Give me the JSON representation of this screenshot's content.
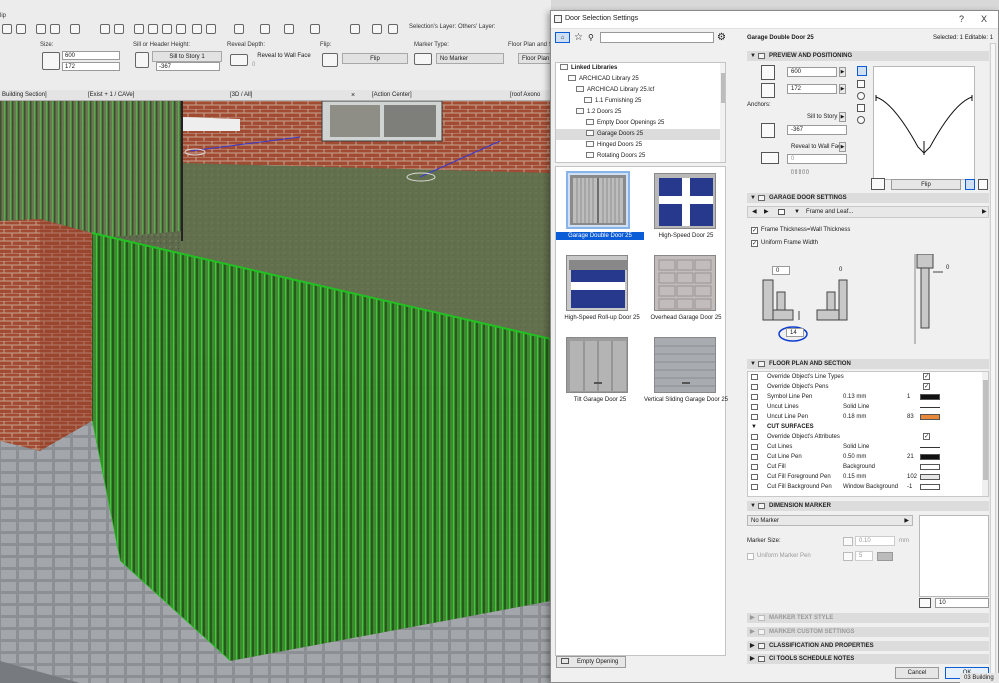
{
  "toolbar": {
    "partial_label": "lip",
    "size_label": "Size:",
    "width": "600",
    "height": "172",
    "sill_label": "Sill or Header Height:",
    "sill_mode": "Sill to Story 1",
    "sill_value": "-367",
    "reveal_label": "Reveal Depth:",
    "reveal_mode": "Reveal to Wall Face",
    "reveal_value": "0",
    "flip_label": "Flip:",
    "flip_button": "Flip",
    "marker_label": "Marker Type:",
    "marker_value": "No Marker",
    "layers_label": "Selection's Layer:",
    "others_label": "Others' Layer:",
    "floorplan_label": "Floor Plan and Section",
    "floorplan_button": "Floor Plan"
  },
  "tabs": [
    "Building Section]",
    "[Exist + 1 / CAVe]",
    "[3D / All]",
    "[Action Center]",
    "[roof Axono"
  ],
  "dialog": {
    "title": "Door Selection Settings",
    "help": "?",
    "close": "X",
    "object_name": "Garage Double Door 25",
    "selected_info": "Selected: 1 Editable: 1",
    "search_placeholder": "",
    "tree": [
      {
        "label": "Linked Libraries",
        "bold": true
      },
      {
        "label": "ARCHICAD Library 25"
      },
      {
        "label": "ARCHICAD Library 25.lcf"
      },
      {
        "label": "1.1 Furnishing 25"
      },
      {
        "label": "1.2 Doors 25"
      },
      {
        "label": "Empty Door Openings 25"
      },
      {
        "label": "Garage Doors 25",
        "selected": true
      },
      {
        "label": "Hinged Doors 25"
      },
      {
        "label": "Rotating Doors 25"
      }
    ],
    "thumbnails": [
      {
        "label": "Garage Double Door 25",
        "selected": true
      },
      {
        "label": "High-Speed Door 25"
      },
      {
        "label": "High-Speed Roll-up Door 25"
      },
      {
        "label": "Overhead Garage Door 25"
      },
      {
        "label": "Tilt Garage Door 25"
      },
      {
        "label": "Vertical Sliding Garage Door 25"
      }
    ],
    "empty_opening_button": "Empty Opening",
    "sections": {
      "preview": "PREVIEW AND POSITIONING",
      "garage": "GARAGE DOOR SETTINGS",
      "floor": "FLOOR PLAN AND SECTION",
      "dimension": "DIMENSION MARKER",
      "marker_text": "MARKER TEXT STYLE",
      "marker_custom": "MARKER CUSTOM SETTINGS",
      "classification": "CLASSIFICATION AND PROPERTIES",
      "ci_tools": "CI TOOLS SCHEDULE NOTES"
    },
    "preview": {
      "width": "600",
      "height": "172",
      "anchors_label": "Anchors:",
      "sill_mode": "Sill to Story 1",
      "sill_value": "-367",
      "reveal_mode": "Reveal to Wall Face",
      "reveal_value": "0",
      "flip_button": "Flip"
    },
    "garage": {
      "page": "Frame and Leaf...",
      "frame_thickness": "Frame Thickness=Wall Thickness",
      "uniform_frame": "Uniform Frame Width",
      "dim_a": "0",
      "dim_b": "0",
      "dim_c": "14",
      "dim_d": "0"
    },
    "floor_rows": [
      {
        "name": "Override Object's Line Types",
        "value": "",
        "pen": "",
        "check": true
      },
      {
        "name": "Override Object's Pens",
        "value": "",
        "pen": "",
        "check": true
      },
      {
        "name": "Symbol Line Pen",
        "value": "0.13 mm",
        "pen": "1",
        "color": "#111111"
      },
      {
        "name": "Uncut Lines",
        "value": "Solid Line",
        "pen": "",
        "line": true
      },
      {
        "name": "Uncut Line Pen",
        "value": "0.18 mm",
        "pen": "83",
        "color": "#e8893a"
      },
      {
        "name": "CUT SURFACES",
        "value": "",
        "pen": "",
        "header": true
      },
      {
        "name": "Override Object's Attributes",
        "value": "",
        "pen": "",
        "check": true
      },
      {
        "name": "Cut Lines",
        "value": "Solid Line",
        "pen": "",
        "line": true
      },
      {
        "name": "Cut Line Pen",
        "value": "0.50 mm",
        "pen": "21",
        "color": "#111111"
      },
      {
        "name": "Cut Fill",
        "value": "Background",
        "pen": "",
        "color": "#ffffff"
      },
      {
        "name": "Cut Fill Foreground Pen",
        "value": "0.15 mm",
        "pen": "102",
        "color": "#e6e6e6"
      },
      {
        "name": "Cut Fill Background Pen",
        "value": "Window Background",
        "pen": "-1",
        "color": "#ffffff"
      }
    ],
    "dimension": {
      "marker_value": "No Marker",
      "marker_size_label": "Marker Size:",
      "marker_size": "0.10",
      "marker_size_unit": "mm",
      "uniform_pen_label": "Uniform Marker Pen",
      "uniform_pen_value": "5",
      "preview_value": "10"
    },
    "cancel_button": "Cancel",
    "ok_button": "OK"
  },
  "status_text": "03 Building",
  "colors": {
    "accent": "#0b5cd7",
    "selection_green": "#22c022",
    "selected_row": "#cfe0f5"
  }
}
